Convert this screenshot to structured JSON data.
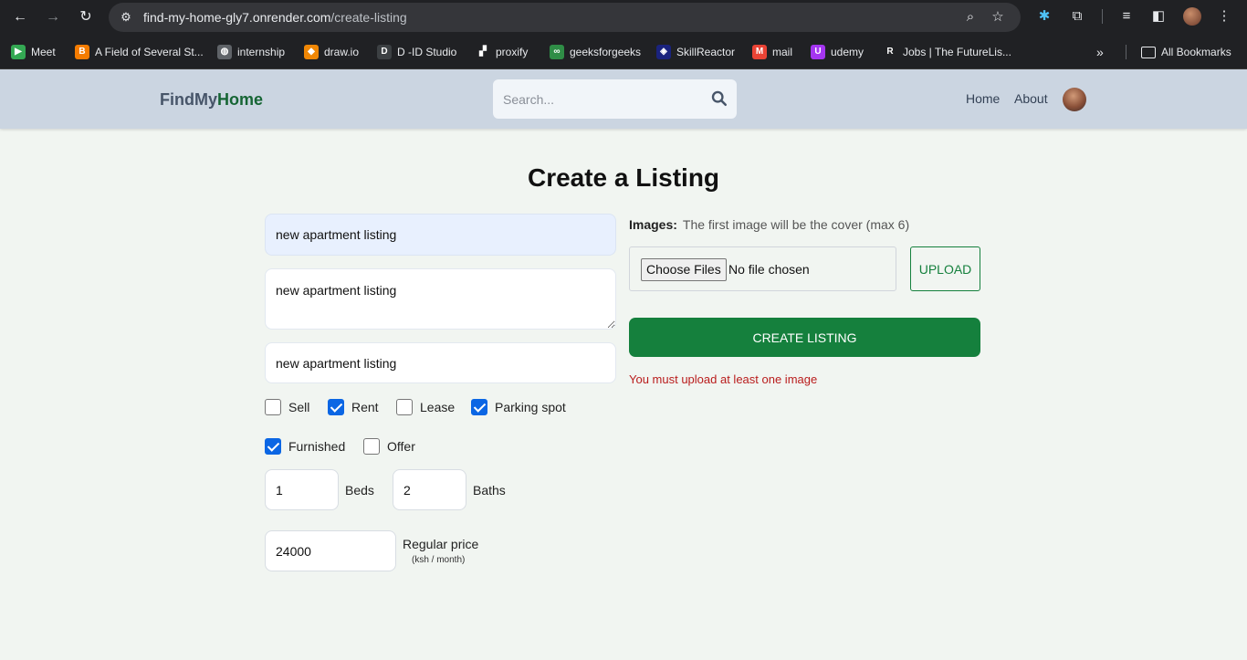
{
  "browser": {
    "url_host": "find-my-home-gly7.onrender.com",
    "url_path": "/create-listing",
    "bookmarks": [
      {
        "label": "Meet",
        "color": "#34a853",
        "glyph": "▶"
      },
      {
        "label": "A Field of Several St...",
        "color": "#f57c00",
        "glyph": "B"
      },
      {
        "label": "internship",
        "color": "#5f6368",
        "glyph": "◍"
      },
      {
        "label": "draw.io",
        "color": "#f08705",
        "glyph": "◆"
      },
      {
        "label": "D -ID Studio",
        "color": "#3c4043",
        "glyph": "D"
      },
      {
        "label": "proxify",
        "color": "#202124",
        "glyph": "▞"
      },
      {
        "label": "geeksforgeeks",
        "color": "#2f8d46",
        "glyph": "∞"
      },
      {
        "label": "SkillReactor",
        "color": "#1a237e",
        "glyph": "◈"
      },
      {
        "label": "mail",
        "color": "#ea4335",
        "glyph": "M"
      },
      {
        "label": "udemy",
        "color": "#a435f0",
        "glyph": "U"
      },
      {
        "label": "Jobs | The FutureLis...",
        "color": "#202124",
        "glyph": "R"
      }
    ],
    "all_bookmarks": "All Bookmarks"
  },
  "header": {
    "logo_part1": "FindMy",
    "logo_part2": "Home",
    "search_placeholder": "Search...",
    "nav": [
      "Home",
      "About"
    ]
  },
  "form": {
    "title": "Create a Listing",
    "name_value": "new apartment listing",
    "description_value": "new apartment listing",
    "address_value": "new apartment listing",
    "checkboxes": [
      {
        "label": "Sell",
        "checked": false
      },
      {
        "label": "Rent",
        "checked": true
      },
      {
        "label": "Lease",
        "checked": false
      },
      {
        "label": "Parking spot",
        "checked": true
      },
      {
        "label": "Furnished",
        "checked": true
      },
      {
        "label": "Offer",
        "checked": false
      }
    ],
    "beds_value": "1",
    "beds_label": "Beds",
    "baths_value": "2",
    "baths_label": "Baths",
    "price_value": "24000",
    "price_label": "Regular price",
    "price_unit": "(ksh / month)",
    "images_label": "Images:",
    "images_hint": "The first image will be the cover (max 6)",
    "choose_files": "Choose Files",
    "file_status": "No file chosen",
    "upload": "UPLOAD",
    "create": "CREATE LISTING",
    "error": "You must upload at least one image"
  },
  "colors": {
    "brand_green": "#15803d",
    "header_bg": "#cbd5e1",
    "error_red": "#b91c1c"
  }
}
